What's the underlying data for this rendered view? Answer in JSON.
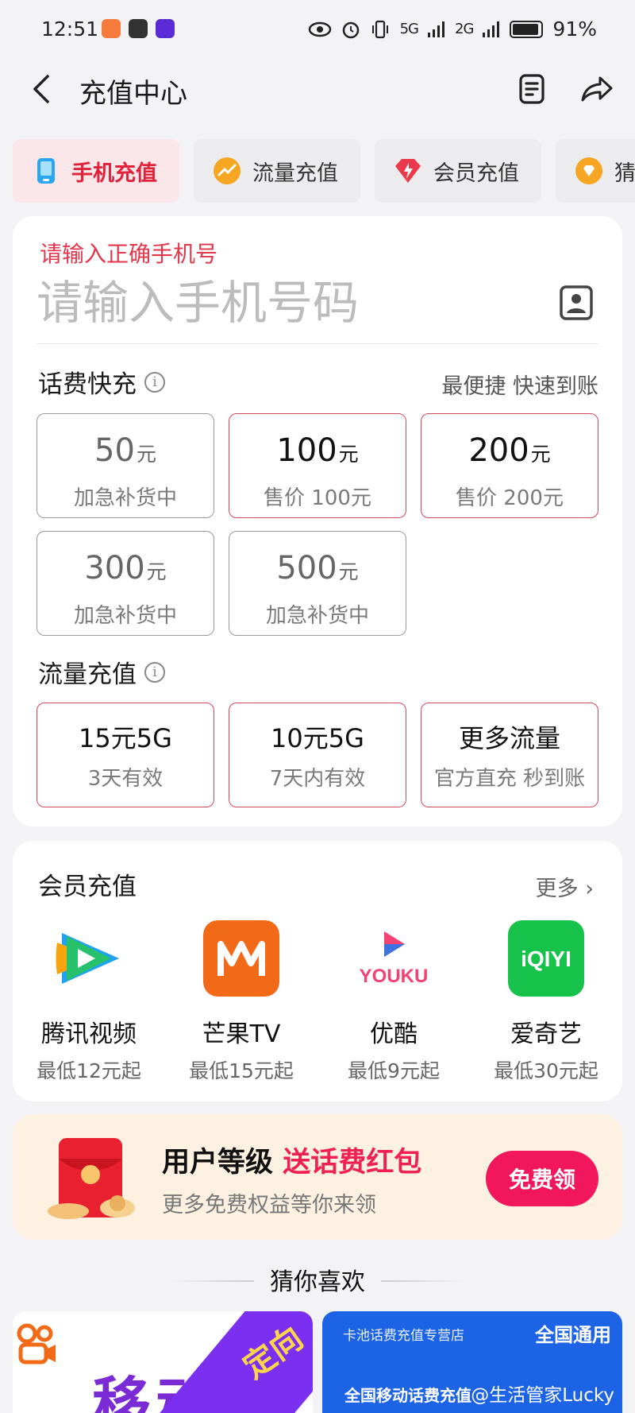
{
  "status_bar": {
    "time": "12:51",
    "battery": "91%",
    "signal_1": "5G",
    "signal_2": "2G"
  },
  "header": {
    "back_icon": "chevron-left-icon",
    "title": "充值中心",
    "note_icon": "document-icon",
    "share_icon": "share-icon"
  },
  "tabs": [
    {
      "label": "手机充值",
      "icon": "phone-icon",
      "active": true
    },
    {
      "label": "流量充值",
      "icon": "traffic-icon",
      "active": false
    },
    {
      "label": "会员充值",
      "icon": "diamond-icon",
      "active": false
    },
    {
      "label": "猜",
      "icon": "gem-icon",
      "active": false
    }
  ],
  "phone": {
    "warning": "请输入正确手机号",
    "placeholder": "请输入手机号码",
    "contact_icon": "contact-book-icon"
  },
  "quick_charge": {
    "title": "话费快充",
    "subtitle": "最便捷 快速到账",
    "unit": "元",
    "options": [
      {
        "amount": "50",
        "status": "加急补货中",
        "available": false
      },
      {
        "amount": "100",
        "status": "售价 100元",
        "available": true
      },
      {
        "amount": "200",
        "status": "售价 200元",
        "available": true
      },
      {
        "amount": "300",
        "status": "加急补货中",
        "available": false
      },
      {
        "amount": "500",
        "status": "加急补货中",
        "available": false
      }
    ]
  },
  "data_charge": {
    "title": "流量充值",
    "options": [
      {
        "label": "15元5G",
        "detail": "3天有效"
      },
      {
        "label": "10元5G",
        "detail": "7天内有效"
      },
      {
        "label": "更多流量",
        "detail": "官方直充 秒到账"
      }
    ]
  },
  "membership": {
    "title": "会员充值",
    "more": "更多",
    "items": [
      {
        "name": "腾讯视频",
        "price": "最低12元起",
        "logo": "tencent-video-logo"
      },
      {
        "name": "芒果TV",
        "price": "最低15元起",
        "logo": "mango-tv-logo"
      },
      {
        "name": "优酷",
        "price": "最低9元起",
        "logo": "youku-logo",
        "logo_text": "YOUKU"
      },
      {
        "name": "爱奇艺",
        "price": "最低30元起",
        "logo": "iqiyi-logo",
        "logo_text": "iQIYI"
      }
    ]
  },
  "promo": {
    "line1_a": "用户等级",
    "line1_b": "送话费红包",
    "line2": "更多免费权益等你来领",
    "button": "免费领"
  },
  "guess": {
    "title": "猜你喜欢"
  },
  "products": [
    {
      "title": "移动",
      "badge": "定向"
    },
    {
      "store": "卡池话费充值专营店",
      "tag": "全国通用",
      "title": "全国移动话费充值",
      "watermark": "@生活管家Lucky"
    }
  ],
  "colors": {
    "accent": "#e0223a",
    "promo_button": "#f2165d",
    "page_bg": "#f3f3f5"
  }
}
